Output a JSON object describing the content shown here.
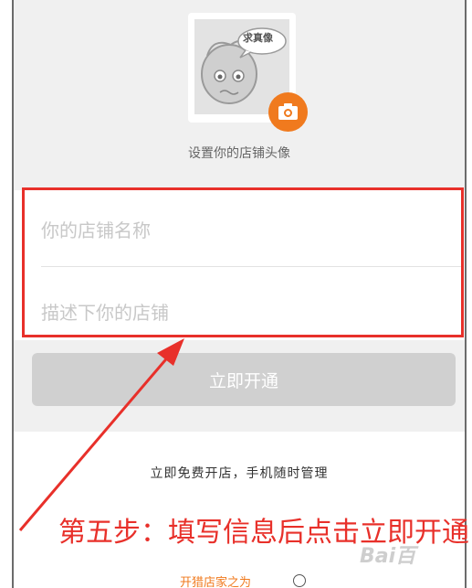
{
  "avatar": {
    "bubble_text": "求真像",
    "caption": "设置你的店铺头像",
    "icon": "camera-icon"
  },
  "form": {
    "name_placeholder": "你的店铺名称",
    "desc_placeholder": "描述下你的店铺"
  },
  "action": {
    "open_label": "立即开通"
  },
  "slogan": "立即免费开店，手机随时管理",
  "footer": {
    "link_text": "开猎店家之为",
    "icon": "info-icon"
  },
  "annotation": {
    "text": "第五步：填写信息后点击立即开通",
    "color": "#e8302a"
  },
  "watermark": "Bai百"
}
